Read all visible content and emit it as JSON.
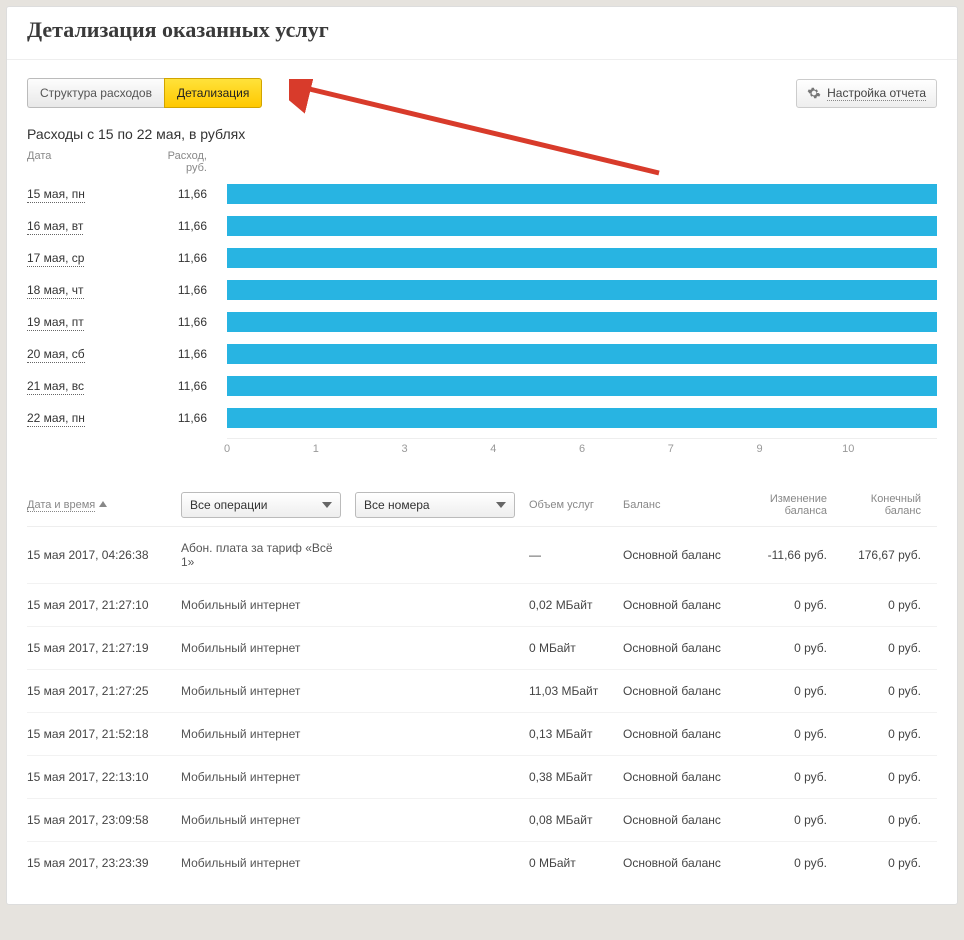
{
  "page_title": "Детализация оказанных услуг",
  "tabs": {
    "structure": "Структура расходов",
    "details": "Детализация"
  },
  "settings_button": "Настройка отчета",
  "subtitle": "Расходы с 15 по 22 мая, в рублях",
  "chart_head": {
    "date": "Дата",
    "value": "Расход, руб."
  },
  "chart_data": {
    "type": "bar",
    "categories": [
      "15 мая, пн",
      "16 мая, вт",
      "17 мая, ср",
      "18 мая, чт",
      "19 мая, пт",
      "20 мая, сб",
      "21 мая, вс",
      "22 мая, пн"
    ],
    "values": [
      11.66,
      11.66,
      11.66,
      11.66,
      11.66,
      11.66,
      11.66,
      11.66
    ],
    "value_labels": [
      "11,66",
      "11,66",
      "11,66",
      "11,66",
      "11,66",
      "11,66",
      "11,66",
      "11,66"
    ],
    "ticks": [
      "0",
      "1",
      "3",
      "4",
      "6",
      "7",
      "9",
      "10"
    ],
    "tick_positions_pct": [
      0,
      12.5,
      25,
      37.5,
      50,
      62.5,
      75,
      87.5
    ],
    "xlabel": "",
    "ylabel": "",
    "title": "",
    "ylim": [
      0,
      12
    ]
  },
  "filters": {
    "datetime": "Дата и время",
    "select_operations": "Все операции",
    "select_numbers": "Все номера",
    "volume": "Объем услуг",
    "balance": "Баланс",
    "change": "Изменение баланса",
    "end": "Конечный баланс"
  },
  "rows": [
    {
      "dt": "15 мая 2017, 04:26:38",
      "type": "Абон. плата за тариф «Всё 1»",
      "vol": "—",
      "bal": "Основной баланс",
      "chg": "-11,66 руб.",
      "end": "176,67 руб."
    },
    {
      "dt": "15 мая 2017, 21:27:10",
      "type": "Мобильный интернет",
      "vol": "0,02 МБайт",
      "bal": "Основной баланс",
      "chg": "0 руб.",
      "end": "0 руб."
    },
    {
      "dt": "15 мая 2017, 21:27:19",
      "type": "Мобильный интернет",
      "vol": "0 МБайт",
      "bal": "Основной баланс",
      "chg": "0 руб.",
      "end": "0 руб."
    },
    {
      "dt": "15 мая 2017, 21:27:25",
      "type": "Мобильный интернет",
      "vol": "11,03 МБайт",
      "bal": "Основной баланс",
      "chg": "0 руб.",
      "end": "0 руб."
    },
    {
      "dt": "15 мая 2017, 21:52:18",
      "type": "Мобильный интернет",
      "vol": "0,13 МБайт",
      "bal": "Основной баланс",
      "chg": "0 руб.",
      "end": "0 руб."
    },
    {
      "dt": "15 мая 2017, 22:13:10",
      "type": "Мобильный интернет",
      "vol": "0,38 МБайт",
      "bal": "Основной баланс",
      "chg": "0 руб.",
      "end": "0 руб."
    },
    {
      "dt": "15 мая 2017, 23:09:58",
      "type": "Мобильный интернет",
      "vol": "0,08 МБайт",
      "bal": "Основной баланс",
      "chg": "0 руб.",
      "end": "0 руб."
    },
    {
      "dt": "15 мая 2017, 23:23:39",
      "type": "Мобильный интернет",
      "vol": "0 МБайт",
      "bal": "Основной баланс",
      "chg": "0 руб.",
      "end": "0 руб."
    }
  ]
}
